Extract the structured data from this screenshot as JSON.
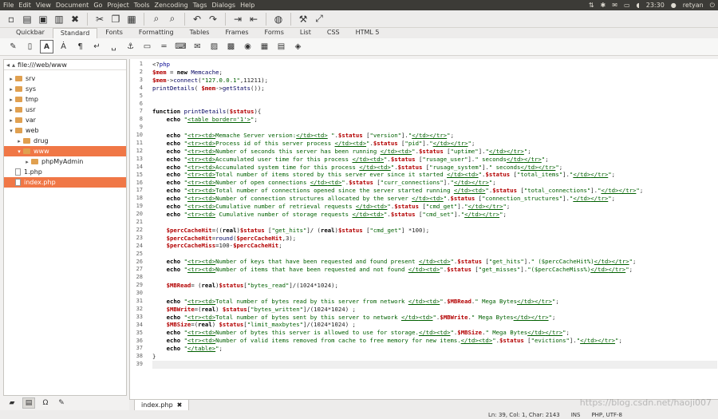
{
  "menubar": {
    "items": [
      "File",
      "Edit",
      "View",
      "Document",
      "Go",
      "Project",
      "Tools",
      "Zencoding",
      "Tags",
      "Dialogs",
      "Help"
    ],
    "clock": "23:30",
    "user": "retyan"
  },
  "tabs": [
    "Quickbar",
    "Standard",
    "Fonts",
    "Formatting",
    "Tables",
    "Frames",
    "Forms",
    "List",
    "CSS",
    "HTML 5"
  ],
  "active_tab": "Standard",
  "sidebar": {
    "path": "file:///web/www",
    "tree": [
      {
        "label": "srv",
        "type": "folder",
        "depth": 0,
        "expanded": false,
        "selected": false
      },
      {
        "label": "sys",
        "type": "folder",
        "depth": 0,
        "expanded": false,
        "selected": false
      },
      {
        "label": "tmp",
        "type": "folder",
        "depth": 0,
        "expanded": false,
        "selected": false
      },
      {
        "label": "usr",
        "type": "folder",
        "depth": 0,
        "expanded": false,
        "selected": false
      },
      {
        "label": "var",
        "type": "folder",
        "depth": 0,
        "expanded": false,
        "selected": false
      },
      {
        "label": "web",
        "type": "folder",
        "depth": 0,
        "expanded": true,
        "selected": false
      },
      {
        "label": "drug",
        "type": "folder",
        "depth": 1,
        "expanded": false,
        "selected": false
      },
      {
        "label": "www",
        "type": "folder",
        "depth": 1,
        "expanded": true,
        "selected": true
      },
      {
        "label": "phpMyAdmin",
        "type": "folder",
        "depth": 2,
        "expanded": false,
        "selected": false
      },
      {
        "label": "1.php",
        "type": "file",
        "depth": 0,
        "expanded": false,
        "selected": false
      },
      {
        "label": "index.php",
        "type": "file",
        "depth": 0,
        "expanded": false,
        "selected": true
      }
    ]
  },
  "editor": {
    "lines": [
      "<?php",
      "$mem = new Memcache;",
      "$mem->connect(\"127.0.0.1\",11211);",
      "printDetails( $mem->getStats());",
      "",
      "",
      "function printDetails($status){",
      "    echo \"<table border='1'>\";",
      "",
      "    echo \"<tr><td>Memache Server version:</td><td> \".$status [\"version\"].\"</td></tr>\";",
      "    echo \"<tr><td>Process id of this server process </td><td>\".$status [\"pid\"].\"</td></tr>\";",
      "    echo \"<tr><td>Number of seconds this server has been running </td><td>\".$status [\"uptime\"].\"</td></tr>\";",
      "    echo \"<tr><td>Accumulated user time for this process </td><td>\".$status [\"rusage_user\"].\" seconds</td></tr>\";",
      "    echo \"<tr><td>Accumulated system time for this process </td><td>\".$status [\"rusage_system\"].\" seconds</td></tr>\";",
      "    echo \"<tr><td>Total number of items stored by this server ever since it started </td><td>\".$status [\"total_items\"].\"</td></tr>\";",
      "    echo \"<tr><td>Number of open connections </td><td>\".$status [\"curr_connections\"].\"</td></tr>\";",
      "    echo \"<tr><td>Total number of connections opened since the server started running </td><td>\".$status [\"total_connections\"].\"</td></tr>\";",
      "    echo \"<tr><td>Number of connection structures allocated by the server </td><td>\".$status [\"connection_structures\"].\"</td></tr>\";",
      "    echo \"<tr><td>Cumulative number of retrieval requests </td><td>\".$status [\"cmd_get\"].\"</td></tr>\";",
      "    echo \"<tr><td> Cumulative number of storage requests </td><td>\".$status [\"cmd_set\"].\"</td></tr>\";",
      "",
      "    $percCacheHit=((real)$status [\"get_hits\"]/ (real)$status [\"cmd_get\"] *100);",
      "    $percCacheHit=round($percCacheHit,3);",
      "    $percCacheMiss=100-$percCacheHit;",
      "",
      "    echo \"<tr><td>Number of keys that have been requested and found present </td><td>\".$status [\"get_hits\"].\" ($percCacheHit%)</td></tr>\";",
      "    echo \"<tr><td>Number of items that have been requested and not found </td><td>\".$status [\"get_misses\"].\"($percCacheMiss%)</td></tr>\";",
      "",
      "    $MBRead= (real)$status[\"bytes_read\"]/(1024*1024);",
      "",
      "    echo \"<tr><td>Total number of bytes read by this server from network </td><td>\".$MBRead.\" Mega Bytes</td></tr>\";",
      "    $MBWrite=(real) $status[\"bytes_written\"]/(1024*1024) ;",
      "    echo \"<tr><td>Total number of bytes sent by this server to network </td><td>\".$MBWrite.\" Mega Bytes</td></tr>\";",
      "    $MBSize=(real) $status[\"limit_maxbytes\"]/(1024*1024) ;",
      "    echo \"<tr><td>Number of bytes this server is allowed to use for storage.</td><td>\".$MBSize.\" Mega Bytes</td></tr>\";",
      "    echo \"<tr><td>Number of valid items removed from cache to free memory for new items.</td><td>\".$status [\"evictions\"].\"</td></tr>\";",
      "    echo \"</table>\";",
      "}",
      ""
    ],
    "current_line": 39
  },
  "doc_tab": {
    "label": "index.php"
  },
  "statusbar": {
    "position": "Ln: 39, Col: 1, Char: 2143",
    "mode": "INS",
    "encoding": "PHP, UTF-8"
  },
  "watermark": "https://blog.csdn.net/haoji007",
  "colors": {
    "selection": "#f07746",
    "topbar": "#3c3b37"
  }
}
